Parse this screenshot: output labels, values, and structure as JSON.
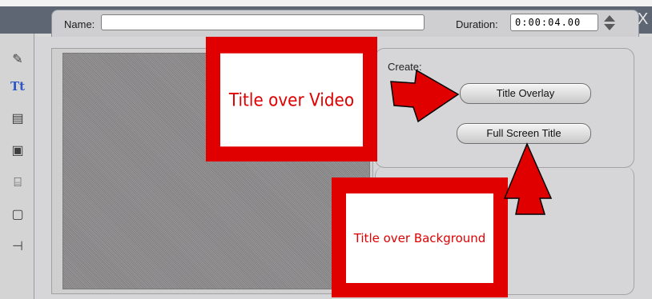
{
  "header": {
    "name_label": "Name:",
    "name_value": "",
    "duration_label": "Duration:",
    "duration_value": "0:00:04.00",
    "close_label": "X"
  },
  "toolbar": {
    "tools": [
      {
        "name": "edit-tool-icon",
        "glyph": "✎"
      },
      {
        "name": "title-tool-icon",
        "glyph": "Tt"
      },
      {
        "name": "audio-tool-icon",
        "glyph": "▤"
      },
      {
        "name": "camera-tool-icon",
        "glyph": "▣"
      },
      {
        "name": "clapper-tool-icon",
        "glyph": "⌸"
      },
      {
        "name": "frame-tool-icon",
        "glyph": "▢"
      },
      {
        "name": "plug-tool-icon",
        "glyph": "⊣"
      }
    ]
  },
  "create": {
    "label": "Create:",
    "title_overlay_button": "Title Overlay",
    "full_screen_title_button": "Full Screen Title"
  },
  "annotations": {
    "video_callout": "Title over Video",
    "background_callout": "Title over Background",
    "color": "#e00000"
  }
}
